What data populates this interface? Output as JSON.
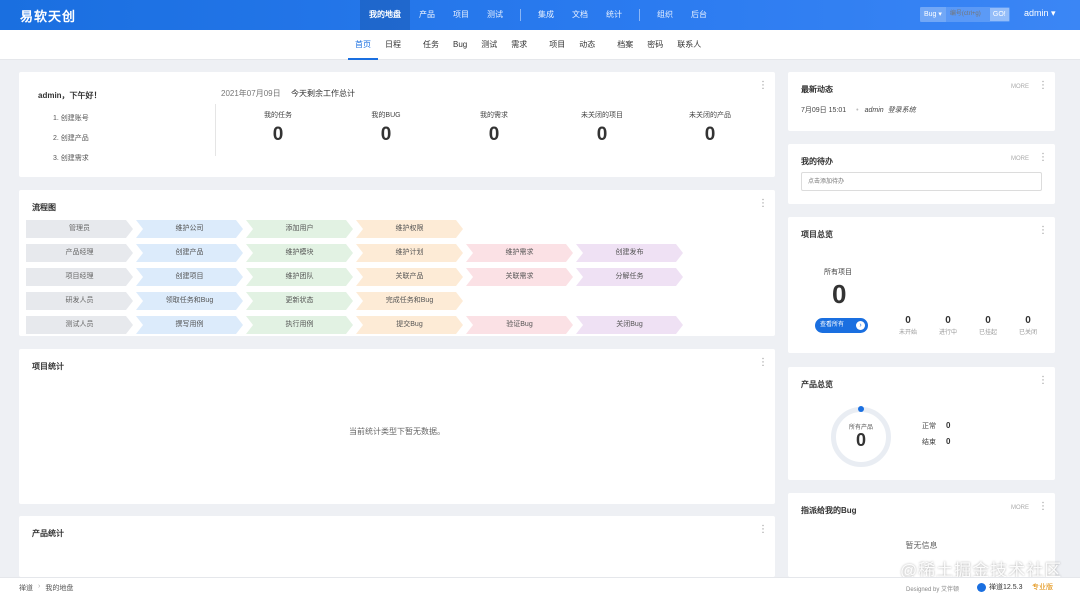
{
  "brand": "易软天创",
  "main_nav": {
    "group1": [
      "我的地盘",
      "产品",
      "项目",
      "测试"
    ],
    "group2": [
      "集成",
      "文档",
      "统计"
    ],
    "group3": [
      "组织",
      "后台"
    ]
  },
  "search": {
    "type": "Bug ▾",
    "placeholder": "编号(ctrl+g)",
    "go": "GO!"
  },
  "user": "admin ▾",
  "sub_nav": [
    "首页",
    "日程",
    "任务",
    "Bug",
    "测试",
    "需求",
    "项目",
    "动态",
    "档案",
    "密码",
    "联系人"
  ],
  "welcome": {
    "greeting": "admin，下午好！",
    "steps": [
      "1. 创建账号",
      "2. 创建产品",
      "3. 创建需求"
    ],
    "date": "2021年07月09日",
    "today_label": "今天剩余工作总计",
    "stats": [
      {
        "label": "我的任务",
        "value": "0"
      },
      {
        "label": "我的BUG",
        "value": "0"
      },
      {
        "label": "我的需求",
        "value": "0"
      },
      {
        "label": "未关闭的项目",
        "value": "0"
      },
      {
        "label": "未关闭的产品",
        "value": "0"
      }
    ]
  },
  "flow": {
    "title": "流程图",
    "rows": [
      [
        {
          "t": "管理员",
          "c": "gray"
        },
        {
          "t": "维护公司",
          "c": "blue"
        },
        {
          "t": "添加用户",
          "c": "green"
        },
        {
          "t": "维护权限",
          "c": "orange"
        }
      ],
      [
        {
          "t": "产品经理",
          "c": "gray"
        },
        {
          "t": "创建产品",
          "c": "blue"
        },
        {
          "t": "维护模块",
          "c": "green"
        },
        {
          "t": "维护计划",
          "c": "orange"
        },
        {
          "t": "维护需求",
          "c": "pink"
        },
        {
          "t": "创建发布",
          "c": "purple"
        }
      ],
      [
        {
          "t": "项目经理",
          "c": "gray"
        },
        {
          "t": "创建项目",
          "c": "blue"
        },
        {
          "t": "维护团队",
          "c": "green"
        },
        {
          "t": "关联产品",
          "c": "orange"
        },
        {
          "t": "关联需求",
          "c": "pink"
        },
        {
          "t": "分解任务",
          "c": "purple"
        }
      ],
      [
        {
          "t": "研发人员",
          "c": "gray"
        },
        {
          "t": "领取任务和Bug",
          "c": "blue"
        },
        {
          "t": "更新状态",
          "c": "green"
        },
        {
          "t": "完成任务和Bug",
          "c": "orange"
        }
      ],
      [
        {
          "t": "测试人员",
          "c": "gray"
        },
        {
          "t": "撰写用例",
          "c": "blue"
        },
        {
          "t": "执行用例",
          "c": "green"
        },
        {
          "t": "提交Bug",
          "c": "orange"
        },
        {
          "t": "验证Bug",
          "c": "pink"
        },
        {
          "t": "关闭Bug",
          "c": "purple"
        }
      ]
    ]
  },
  "project_stats": {
    "title": "项目统计",
    "empty": "当前统计类型下暂无数据。"
  },
  "product_stats": {
    "title": "产品统计"
  },
  "dynamics": {
    "title": "最新动态",
    "more": "MORE",
    "time": "7月09日 15:01",
    "actor": "admin",
    "action": "登录系统"
  },
  "todo": {
    "title": "我的待办",
    "more": "MORE",
    "placeholder": "点击添加待办"
  },
  "project_overview": {
    "title": "项目总览",
    "all_label": "所有项目",
    "all_value": "0",
    "button": "查看所有",
    "sub": [
      {
        "n": "0",
        "t": "未开始"
      },
      {
        "n": "0",
        "t": "进行中"
      },
      {
        "n": "0",
        "t": "已挂起"
      },
      {
        "n": "0",
        "t": "已关闭"
      }
    ]
  },
  "product_overview": {
    "title": "产品总览",
    "ring_label": "所有产品",
    "ring_value": "0",
    "normal_label": "正常",
    "normal_value": "0",
    "closed_label": "结束",
    "closed_value": "0"
  },
  "assigned_bugs": {
    "title": "指派给我的Bug",
    "more": "MORE",
    "empty": "暂无信息"
  },
  "footer": {
    "crumbs": [
      "禅道",
      "我的地盘"
    ],
    "designed": "Designed by 艾伴顿",
    "version": "禅道12.5.3",
    "edition": "专业版"
  },
  "watermark": "@稀土掘金技术社区"
}
